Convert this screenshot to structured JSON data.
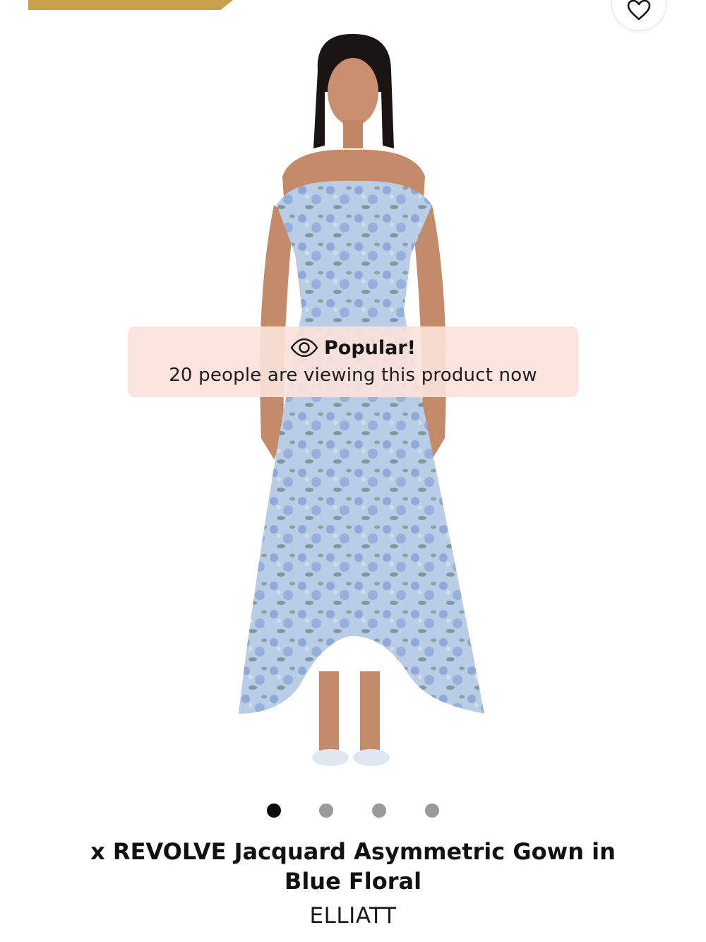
{
  "banner": {
    "color": "#c6a14a"
  },
  "wishlist": {
    "icon": "heart-icon"
  },
  "product_image": {
    "description_icon": "product-photo",
    "dress_color": "#9fb6dc"
  },
  "popular_badge": {
    "icon": "eye-icon",
    "title": "Popular!",
    "subtitle": "20 people are viewing this product now",
    "background": "#fae2da"
  },
  "carousel": {
    "total": 4,
    "active_index": 0
  },
  "product": {
    "title": "x REVOLVE Jacquard Asymmetric Gown in Blue Floral",
    "brand": "ELLIATT"
  }
}
